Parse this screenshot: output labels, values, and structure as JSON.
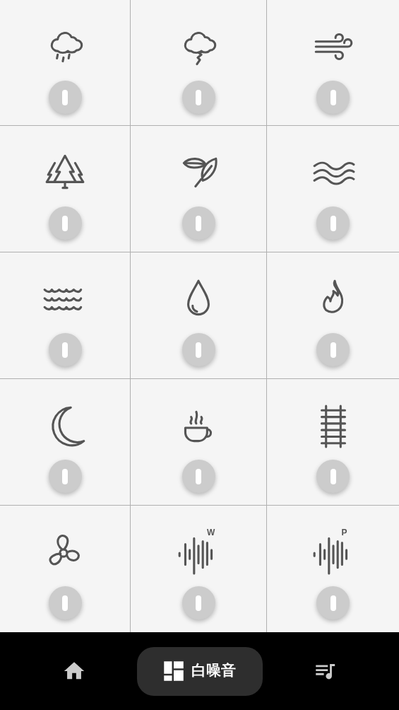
{
  "tiles": [
    {
      "kind": "rain",
      "on": false
    },
    {
      "kind": "thunder",
      "on": false
    },
    {
      "kind": "wind",
      "on": false
    },
    {
      "kind": "forest",
      "on": false
    },
    {
      "kind": "leaf",
      "on": false
    },
    {
      "kind": "stream",
      "on": false
    },
    {
      "kind": "sea",
      "on": false
    },
    {
      "kind": "drop",
      "on": false
    },
    {
      "kind": "fire",
      "on": false
    },
    {
      "kind": "moon",
      "on": false
    },
    {
      "kind": "coffee",
      "on": false
    },
    {
      "kind": "rail",
      "on": false
    },
    {
      "kind": "fan",
      "on": false
    },
    {
      "kind": "noise",
      "on": false,
      "badge": "W"
    },
    {
      "kind": "noise",
      "on": false,
      "badge": "P"
    }
  ],
  "nav": [
    {
      "kind": "home",
      "selected": false
    },
    {
      "kind": "grid",
      "selected": true,
      "label": "白噪音"
    },
    {
      "kind": "playlist",
      "selected": false
    }
  ]
}
